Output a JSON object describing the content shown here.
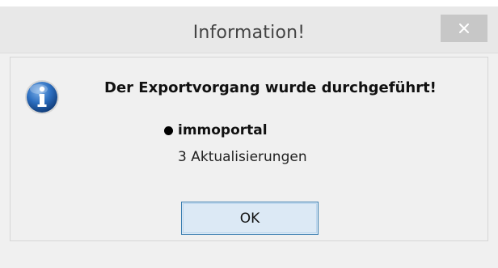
{
  "dialog": {
    "title": "Information!",
    "close_icon": "close-icon",
    "icon": "info-icon",
    "message": "Der Exportvorgang wurde durchgeführt!",
    "portal": "immoportal",
    "updates": "3 Aktualisierungen",
    "ok_label": "OK"
  },
  "colors": {
    "title_bar": "#e8e8e8",
    "close_button": "#c7c7c7",
    "ok_border": "#3c7fb1",
    "ok_fill": "#dce9f5",
    "info_blue": "#1f5fa8"
  }
}
